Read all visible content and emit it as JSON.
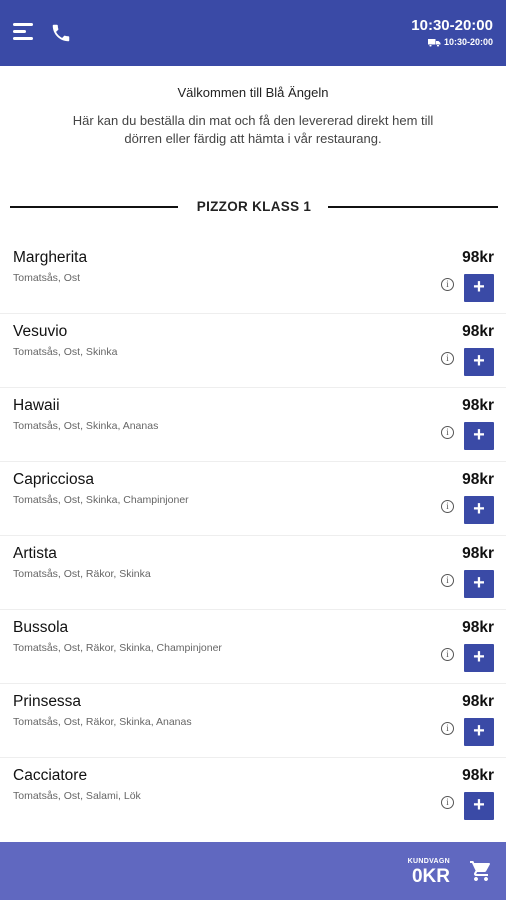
{
  "header": {
    "hours_main": "10:30-20:00",
    "hours_delivery": "10:30-20:00",
    "icons": [
      "menu-icon",
      "phone-icon",
      "truck-icon"
    ]
  },
  "welcome": {
    "title": "Välkommen till Blå Ängeln",
    "text": "Här kan du beställa din mat och få den levererad direkt hem till dörren eller färdig att hämta i vår restaurang."
  },
  "section": {
    "title": "PIZZOR KLASS 1"
  },
  "items": [
    {
      "name": "Margherita",
      "description": "Tomatsås, Ost",
      "price": "98kr"
    },
    {
      "name": "Vesuvio",
      "description": "Tomatsås, Ost, Skinka",
      "price": "98kr"
    },
    {
      "name": "Hawaii",
      "description": "Tomatsås, Ost, Skinka, Ananas",
      "price": "98kr"
    },
    {
      "name": "Capricciosa",
      "description": "Tomatsås, Ost, Skinka, Champinjoner",
      "price": "98kr"
    },
    {
      "name": "Artista",
      "description": "Tomatsås, Ost, Räkor, Skinka",
      "price": "98kr"
    },
    {
      "name": "Bussola",
      "description": "Tomatsås, Ost, Räkor, Skinka, Champinjoner",
      "price": "98kr"
    },
    {
      "name": "Prinsessa",
      "description": "Tomatsås, Ost, Räkor, Skinka, Ananas",
      "price": "98kr"
    },
    {
      "name": "Cacciatore",
      "description": "Tomatsås, Ost, Salami, Lök",
      "price": "98kr"
    }
  ],
  "item_buttons": {
    "info_symbol": "i",
    "add_symbol": "+"
  },
  "cart": {
    "label": "KUNDVAGN",
    "total": "0KR"
  },
  "colors": {
    "header": "#3a4aa6",
    "button": "#3a4aa6",
    "cart_bar": "#6068c0"
  }
}
